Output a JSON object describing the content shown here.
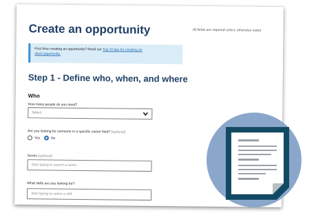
{
  "page": {
    "title": "Create an opportunity",
    "required_note": "All fields are required unless otherwise noted",
    "tip": {
      "prefix": "First time creating an opportunity? Read our",
      "link": "Top 10 tips for creating an",
      "suffix": "ideal opportunity."
    },
    "step_heading": "Step 1 - Define who, when, and where",
    "section_who": "Who",
    "fields": {
      "people_label": "How many people do you need?",
      "people_value": "Select",
      "career_label": "Are you looking for someone in a specific career field?",
      "career_optional": "(optional)",
      "career_options": [
        "Yes",
        "No"
      ],
      "career_selected": "No",
      "series_label": "Series",
      "series_optional": "(optional)",
      "series_placeholder": "Start typing to search a series",
      "skills_label": "What skills are you looking for?",
      "skills_placeholder": "Start typing to select a skill"
    }
  },
  "colors": {
    "heading": "#1f3f66",
    "accent": "#2d6fb3",
    "tip_background": "#d9ecf8",
    "circle": "#8aa7cb",
    "document_icon": "#134a63"
  },
  "overlay_icon": "document-icon"
}
